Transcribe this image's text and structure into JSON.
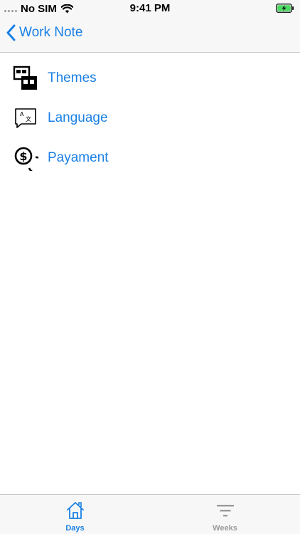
{
  "status_bar": {
    "carrier": "No SIM",
    "time": "9:41 PM"
  },
  "nav": {
    "back_label": "Work Note"
  },
  "menu": {
    "items": [
      {
        "label": "Themes",
        "icon": "themes-icon"
      },
      {
        "label": "Language",
        "icon": "language-icon"
      },
      {
        "label": "Payament",
        "icon": "payment-coins-icon"
      }
    ]
  },
  "tabs": [
    {
      "label": "Days",
      "icon": "home-icon",
      "selected": true
    },
    {
      "label": "Weeks",
      "icon": "filter-icon",
      "selected": false
    }
  ],
  "colors": {
    "accent": "#1a80e5",
    "inactive": "#9a9a9a",
    "bar_background": "#f7f7f7",
    "battery": "#4cd964"
  }
}
